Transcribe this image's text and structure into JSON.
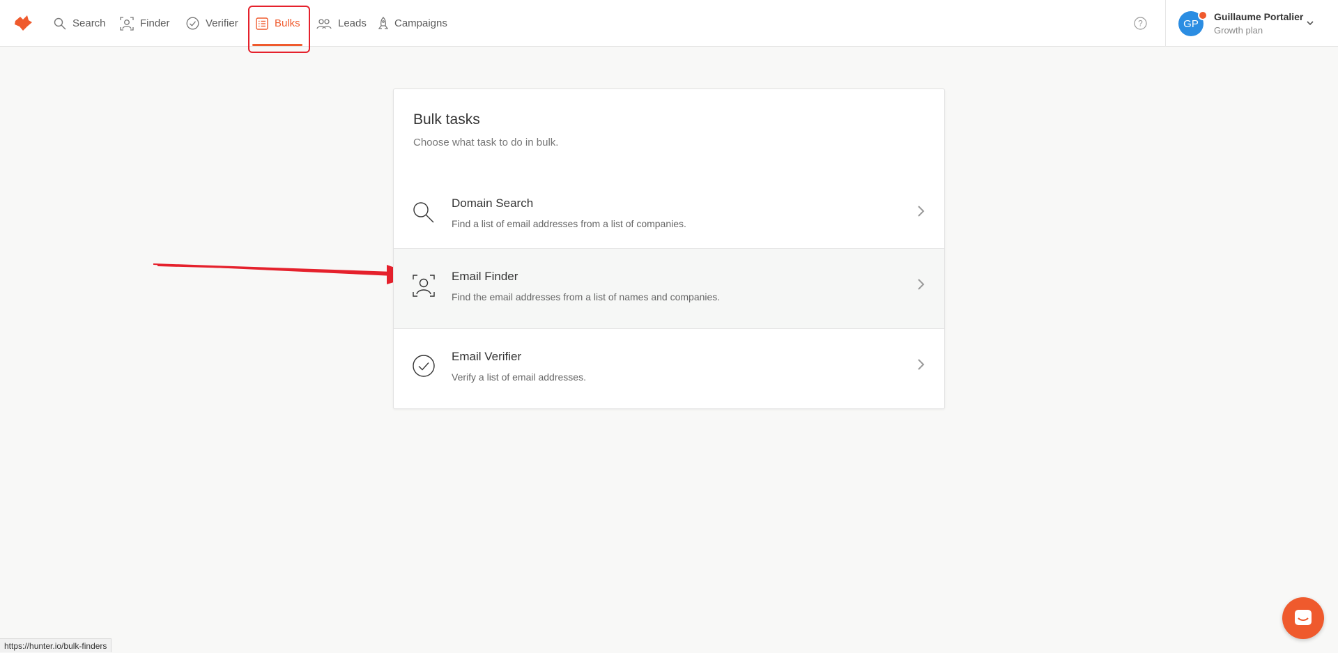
{
  "nav": {
    "items": [
      {
        "label": "Search",
        "icon": "search-icon"
      },
      {
        "label": "Finder",
        "icon": "finder-icon"
      },
      {
        "label": "Verifier",
        "icon": "verifier-icon"
      },
      {
        "label": "Bulks",
        "icon": "bulks-icon",
        "active": true
      },
      {
        "label": "Leads",
        "icon": "leads-icon"
      },
      {
        "label": "Campaigns",
        "icon": "campaigns-icon"
      }
    ]
  },
  "user": {
    "initials": "GP",
    "name": "Guillaume Portalier",
    "plan": "Growth plan"
  },
  "card": {
    "title": "Bulk tasks",
    "subtitle": "Choose what task to do in bulk.",
    "tasks": [
      {
        "title": "Domain Search",
        "description": "Find a list of email addresses from a list of companies.",
        "icon": "search-icon"
      },
      {
        "title": "Email Finder",
        "description": "Find the email addresses from a list of names and companies.",
        "icon": "finder-icon"
      },
      {
        "title": "Email Verifier",
        "description": "Verify a list of email addresses.",
        "icon": "verifier-icon"
      }
    ]
  },
  "status_url": "https://hunter.io/bulk-finders",
  "colors": {
    "accent": "#ef5a2d",
    "avatar": "#2b8de2",
    "annotation": "#e5212c"
  }
}
